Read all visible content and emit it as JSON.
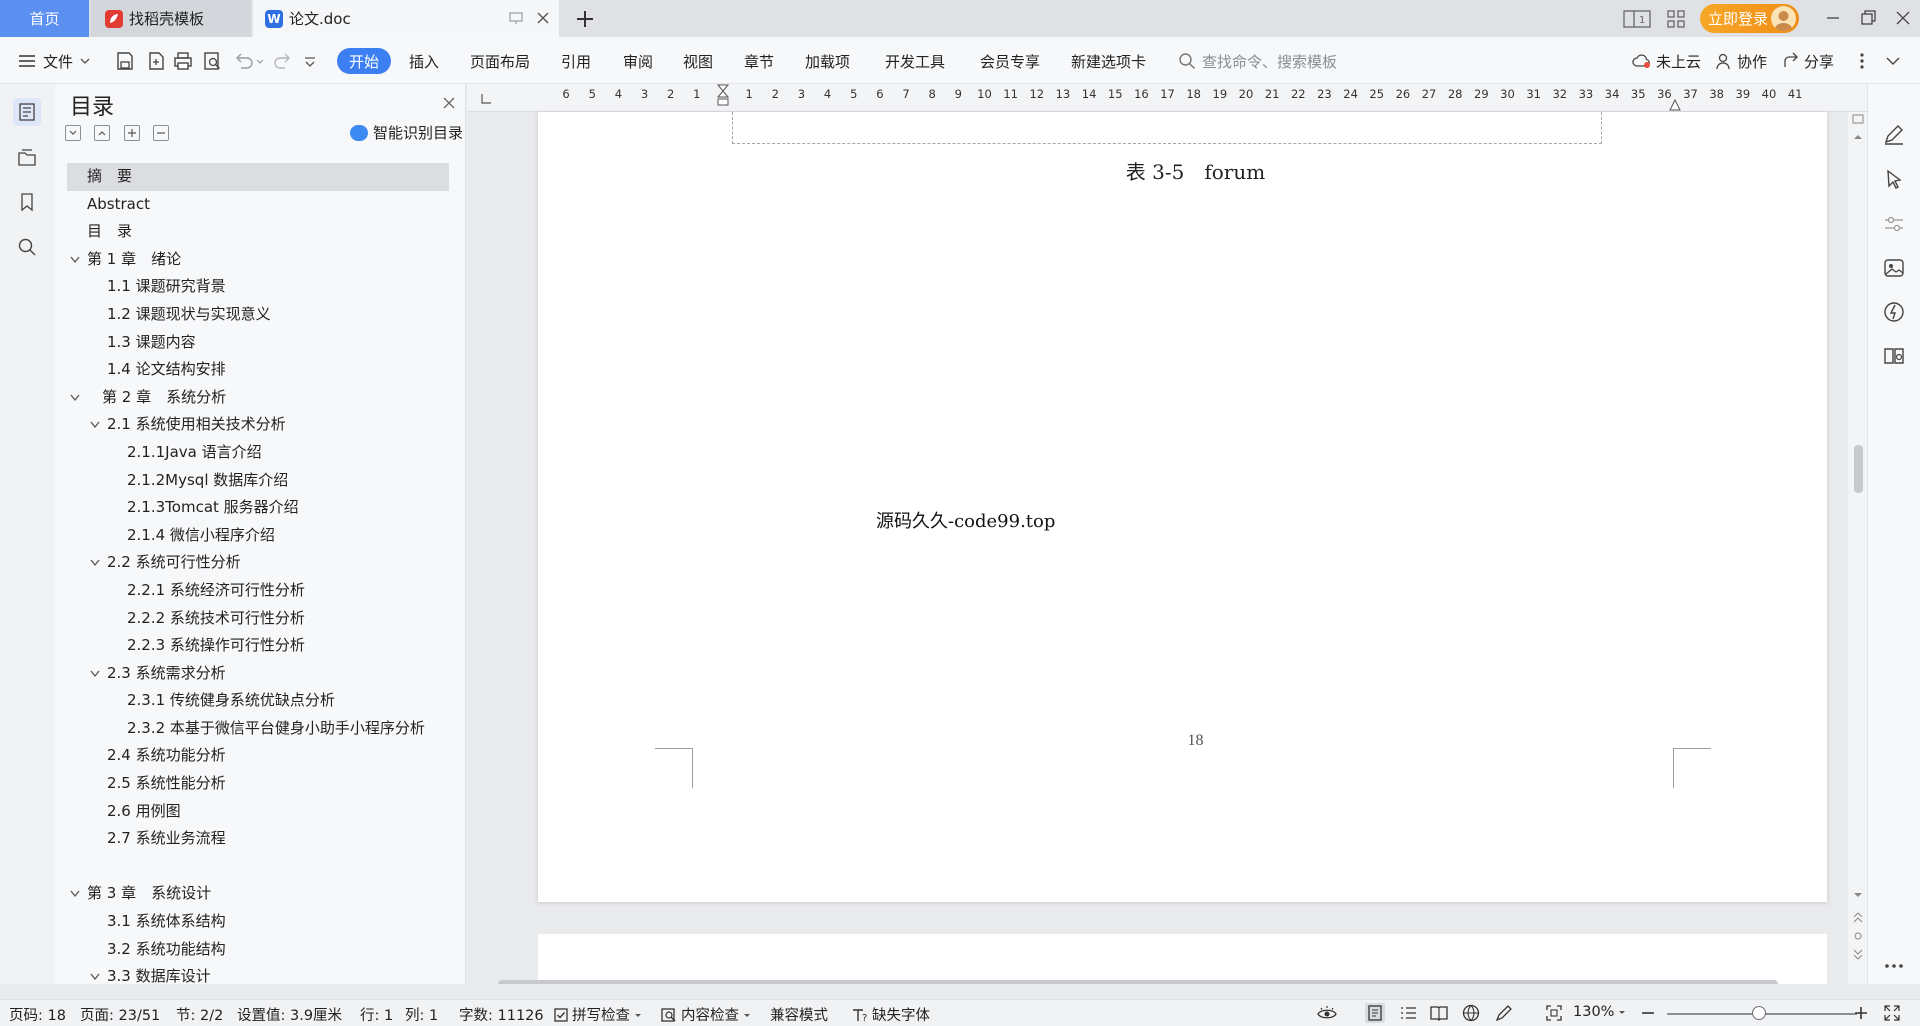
{
  "titlebar": {
    "tabs": [
      {
        "label": "首页"
      },
      {
        "label": "找稻壳模板",
        "icon": "daoke-logo-icon"
      },
      {
        "label": "论文.doc",
        "icon": "wps-writer-icon"
      }
    ],
    "login_label": "立即登录"
  },
  "ribbon": {
    "file_label": "文件",
    "menus": [
      "开始",
      "插入",
      "页面布局",
      "引用",
      "审阅",
      "视图",
      "章节",
      "加载项",
      "开发工具",
      "会员专享",
      "新建选项卡"
    ],
    "search_placeholder": "查找命令、搜索模板",
    "cloud_label": "未上云",
    "collab_label": "协作",
    "share_label": "分享"
  },
  "toc": {
    "title": "目录",
    "smart_label": "智能识别目录",
    "items": [
      {
        "text": "摘　要",
        "level": 0,
        "selected": true
      },
      {
        "text": "Abstract",
        "level": 0
      },
      {
        "text": "目　录",
        "level": 0
      },
      {
        "text": "第 1 章　绪论",
        "level": 0,
        "collapsible": true
      },
      {
        "text": "1.1 课题研究背景",
        "level": 1
      },
      {
        "text": "1.2 课题现状与实现意义",
        "level": 1
      },
      {
        "text": "1.3 课题内容",
        "level": 1
      },
      {
        "text": "1.4 论文结构安排",
        "level": 1
      },
      {
        "text": "　第 2 章　系统分析",
        "level": 0,
        "collapsible": true
      },
      {
        "text": "2.1 系统使用相关技术分析",
        "level": 1,
        "collapsible": true
      },
      {
        "text": "2.1.1Java 语言介绍",
        "level": 2
      },
      {
        "text": "2.1.2Mysql 数据库介绍",
        "level": 2
      },
      {
        "text": "2.1.3Tomcat 服务器介绍",
        "level": 2
      },
      {
        "text": "2.1.4 微信小程序介绍",
        "level": 2
      },
      {
        "text": "2.2 系统可行性分析",
        "level": 1,
        "collapsible": true
      },
      {
        "text": "2.2.1 系统经济可行性分析",
        "level": 2
      },
      {
        "text": "2.2.2 系统技术可行性分析",
        "level": 2
      },
      {
        "text": "2.2.3 系统操作可行性分析",
        "level": 2
      },
      {
        "text": "2.3 系统需求分析",
        "level": 1,
        "collapsible": true
      },
      {
        "text": "2.3.1 传统健身系统优缺点分析",
        "level": 2
      },
      {
        "text": "2.3.2 本基于微信平台健身小助手小程序分析",
        "level": 2
      },
      {
        "text": "2.4 系统功能分析",
        "level": 1
      },
      {
        "text": "2.5 系统性能分析",
        "level": 1
      },
      {
        "text": "2.6 用例图",
        "level": 1
      },
      {
        "text": "2.7 系统业务流程",
        "level": 1
      },
      {
        "text": "",
        "level": 0
      },
      {
        "text": "第 3 章　系统设计",
        "level": 0,
        "collapsible": true
      },
      {
        "text": "3.1 系统体系结构",
        "level": 1
      },
      {
        "text": "3.2 系统功能结构",
        "level": 1
      },
      {
        "text": "3.3 数据库设计",
        "level": 1,
        "collapsible": true
      }
    ]
  },
  "ruler": {
    "ticks": [
      "6",
      "5",
      "4",
      "3",
      "2",
      "1",
      "1",
      "2",
      "3",
      "4",
      "5",
      "6",
      "7",
      "8",
      "9",
      "10",
      "11",
      "12",
      "13",
      "14",
      "15",
      "16",
      "17",
      "18",
      "19",
      "20",
      "21",
      "22",
      "23",
      "24",
      "25",
      "26",
      "27",
      "28",
      "29",
      "30",
      "31",
      "32",
      "33",
      "34",
      "35",
      "36",
      "37",
      "38",
      "39",
      "40",
      "41"
    ]
  },
  "document": {
    "table_caption": "表 3-5　forum",
    "watermark_text": "源码久久-code99.top",
    "page_number": "18"
  },
  "statusbar": {
    "page_code": "页码: 18",
    "page_count": "页面: 23/51",
    "section": "节: 2/2",
    "setting_value": "设置值: 3.9厘米",
    "line": "行: 1",
    "column": "列: 1",
    "word_count": "字数: 11126",
    "spell_check": "拼写检查",
    "content_check": "内容检查",
    "compat_mode": "兼容模式",
    "missing_fonts": "缺失字体",
    "zoom": "130%"
  },
  "colors": {
    "accent": "#3c7ff2",
    "login": "#f39a20",
    "home_tab": "#5b8ff0"
  }
}
